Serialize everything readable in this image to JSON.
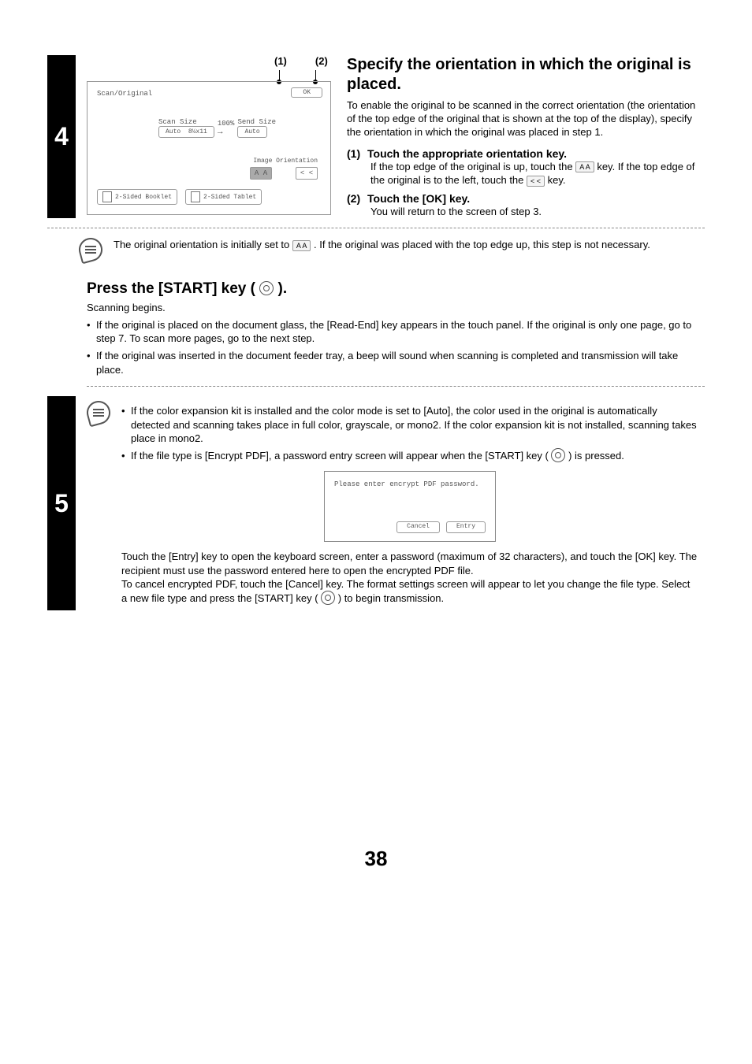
{
  "step4": {
    "number": "4",
    "callout1": "(1)",
    "callout2": "(2)",
    "panel": {
      "title": "Scan/Original",
      "ok": "OK",
      "scanSizeLabel": "Scan Size",
      "percent": "100%",
      "sendSizeLabel": "Send Size",
      "autoBtn1a": "Auto",
      "autoBtn1b": "8½x11",
      "autoBtn2": "Auto",
      "orientLabel": "Image Orientation",
      "orientUp": "A A",
      "orientLeft": "< <",
      "twoSided1": "2-Sided Booklet",
      "twoSided2": "2-Sided Tablet"
    },
    "heading": "Specify the orientation in which the original is placed.",
    "para1": "To enable the original to be scanned in the correct orientation (the orientation of the top edge of the original that is shown at the top of the display), specify the orientation in which the original was placed in step 1.",
    "sub1head": "Touch the appropriate orientation key.",
    "sub1a": "If the top edge of the original is up, touch the ",
    "sub1b": " key. If the top edge of the original is to the left, touch the ",
    "sub1c": " key.",
    "iconUp": "A A",
    "iconLeft": "< <",
    "sub2head": "Touch the [OK] key.",
    "sub2body": "You will return to the screen of step 3.",
    "note1a": "The original orientation is initially set to ",
    "note1b": " . If the original was placed with the top edge up, this step is not necessary.",
    "noteIcon": "A A"
  },
  "step5": {
    "number": "5",
    "heading_a": "Press the [START] key ( ",
    "heading_b": " ).",
    "scanBegins": "Scanning begins.",
    "bul1": "If the original is placed on the document glass, the [Read-End] key appears in the touch panel. If the original is only one page, go to step 7. To scan more pages, go to the next step.",
    "bul2": "If the original was inserted in the document feeder tray, a beep will sound when scanning is completed and transmission will take place.",
    "noteBul1": "If the color expansion kit is installed and the color mode is set to [Auto], the color used in the original is automatically detected and scanning takes place in full color, grayscale, or mono2. If the color expansion kit is not installed, scanning takes place in mono2.",
    "noteBul2a": "If the file type is [Encrypt PDF], a password entry screen will appear when the [START] key ( ",
    "noteBul2b": " ) is pressed.",
    "pwPanel": {
      "msg": "Please enter encrypt PDF password.",
      "cancel": "Cancel",
      "entry": "Entry"
    },
    "para2": "Touch the [Entry] key to open the keyboard screen, enter a password (maximum of 32 characters), and touch the [OK] key. The recipient must use the password entered here to open the encrypted PDF file.",
    "para3a": "To cancel encrypted PDF, touch the [Cancel] key. The format settings screen will appear to let you change the file type. Select a new file type and press the [START] key ( ",
    "para3b": " ) to begin transmission."
  },
  "pageNum": "38"
}
